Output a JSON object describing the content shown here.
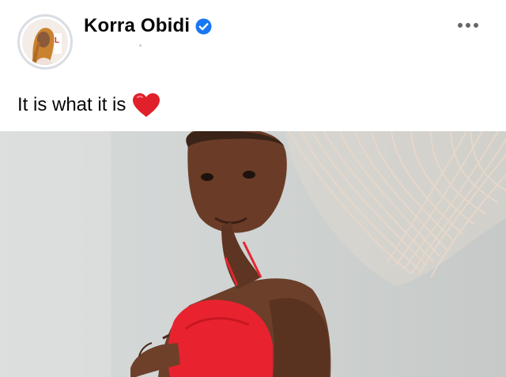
{
  "post": {
    "author": {
      "name": "Korra Obidi",
      "verified": true,
      "avatar_icon": "profile-photo",
      "verified_icon": "verified-badge-icon",
      "verified_color": "#1877f2"
    },
    "more_icon": "more-options-icon",
    "text": "It is what it is",
    "emoji_icon": "red-heart-icon",
    "emoji_color": "#e0202a",
    "media_type": "video"
  }
}
